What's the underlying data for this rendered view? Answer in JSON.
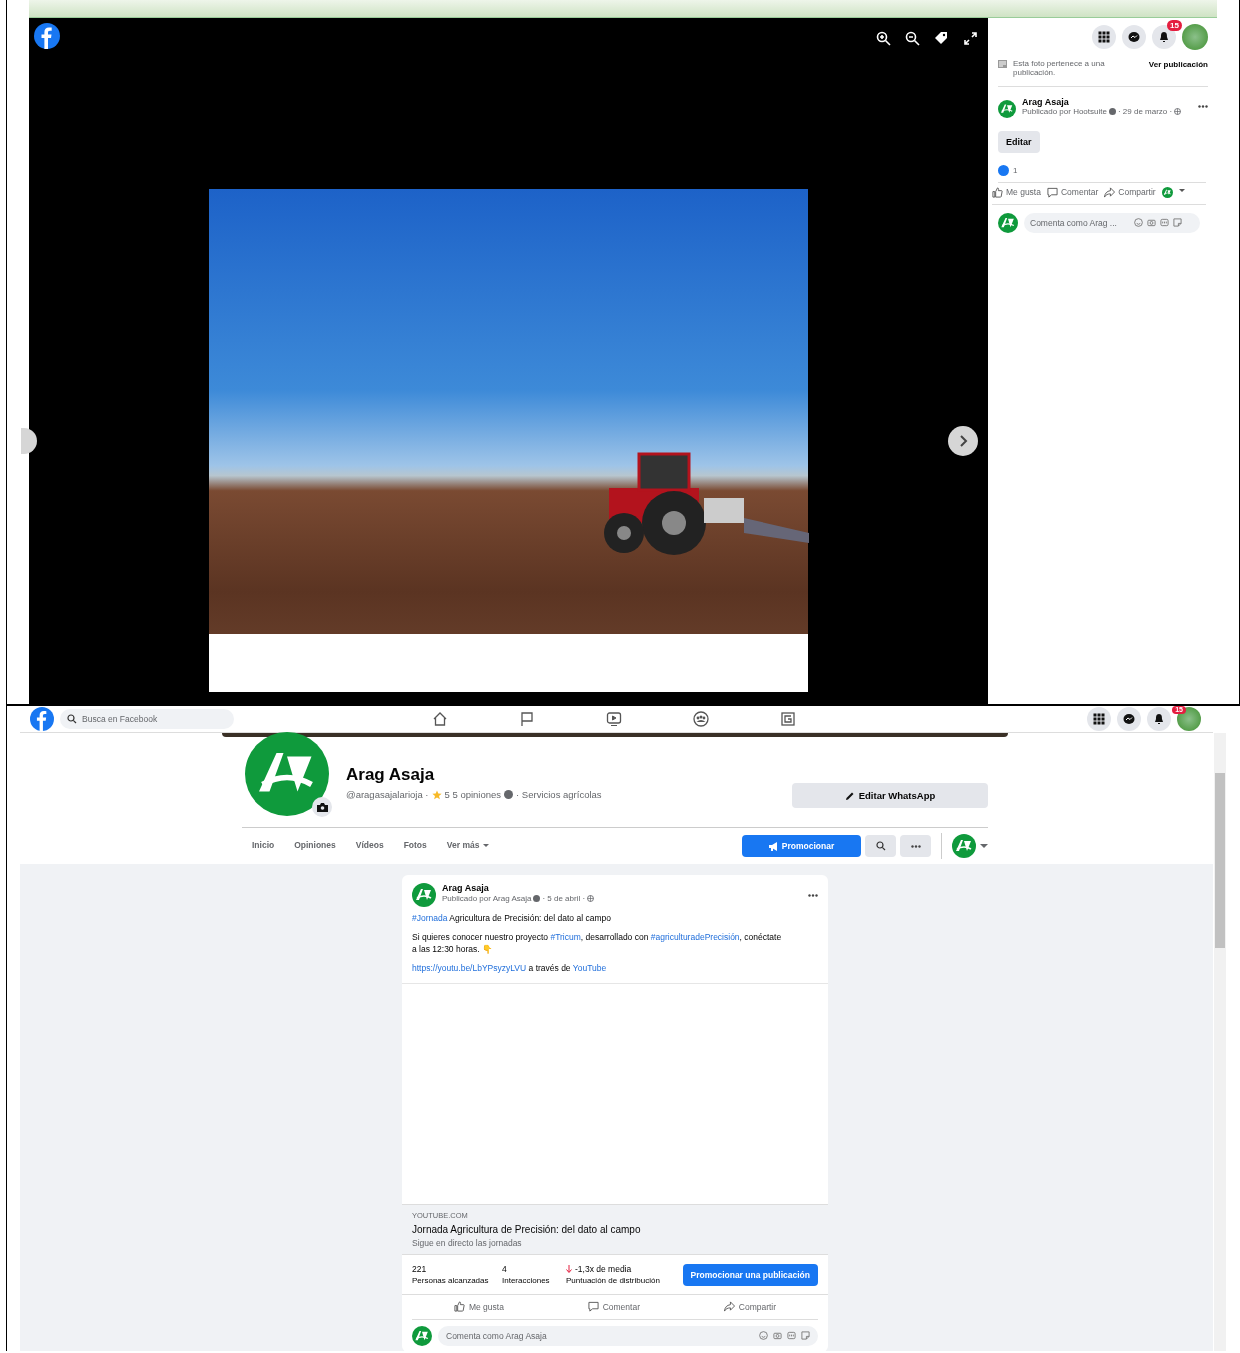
{
  "photo_viewer": {
    "notification_count": "15",
    "photo_notice": "Esta foto pertenece a una publicación.",
    "view_post_link": "Ver publicación",
    "post": {
      "author": "Arag Asaja",
      "meta": "Publicado por Hootsuite",
      "date": "· 29 de marzo ·",
      "edit_button": "Editar",
      "reaction_count": "1",
      "actions": [
        "Me gusta",
        "Comentar",
        "Compartir"
      ],
      "comment_placeholder": "Comenta como Arag ..."
    }
  },
  "page": {
    "search_placeholder": "Busca en Facebook",
    "notification_count": "15",
    "page_name": "Arag Asaja",
    "handle": "@aragasajalarioja ·",
    "rating": "5 5 opiniones",
    "category": "· Servicios agrícolas",
    "whatsapp_button": "Editar WhatsApp",
    "tabs": [
      {
        "label": "Inicio",
        "selected": false
      },
      {
        "label": "Opiniones",
        "selected": false
      },
      {
        "label": "Vídeos",
        "selected": false
      },
      {
        "label": "Fotos",
        "selected": false
      },
      {
        "label": "Ver más",
        "selected": false
      }
    ],
    "promote_button": "Promocionar",
    "post": {
      "author": "Arag Asaja",
      "meta": "Publicado por Arag Asaja",
      "date": "· 5 de abril ·",
      "paragraphs": [
        [
          {
            "kind": "link",
            "text": "#Jornada"
          },
          {
            "kind": "text",
            "text": " Agricultura de Precisión: del dato al campo"
          }
        ],
        [
          {
            "kind": "text",
            "text": "Si quieres conocer nuestro proyecto "
          },
          {
            "kind": "link",
            "text": "#Tricum"
          },
          {
            "kind": "text",
            "text": ", desarrollado con  "
          },
          {
            "kind": "link",
            "text": "#agriculturadePrecisión"
          },
          {
            "kind": "text",
            "text": ", conéctate a las 12:30 horas. 👇"
          }
        ],
        [
          {
            "kind": "link",
            "text": "https://youtu.be/LbYPsyzyLVU"
          },
          {
            "kind": "text",
            "text": " a través de "
          },
          {
            "kind": "link",
            "text": "YouTube"
          }
        ]
      ],
      "link_preview": {
        "domain": "YOUTUBE.COM",
        "title": "Jornada Agricultura de Precisión: del dato al campo",
        "subtitle": "Sigue en directo las jornadas"
      },
      "stats": [
        {
          "kind": "plain",
          "value": "221",
          "label": "Personas alcanzadas"
        },
        {
          "kind": "plain",
          "value": "4",
          "label": "Interacciones"
        },
        {
          "kind": "trend-down",
          "value": "-1,3x de media",
          "label": "Puntuación de distribución"
        }
      ],
      "promote_post_button": "Promocionar una publicación",
      "actions": [
        "Me gusta",
        "Comentar",
        "Compartir"
      ],
      "comment_placeholder": "Comenta como Arag Asaja"
    }
  }
}
